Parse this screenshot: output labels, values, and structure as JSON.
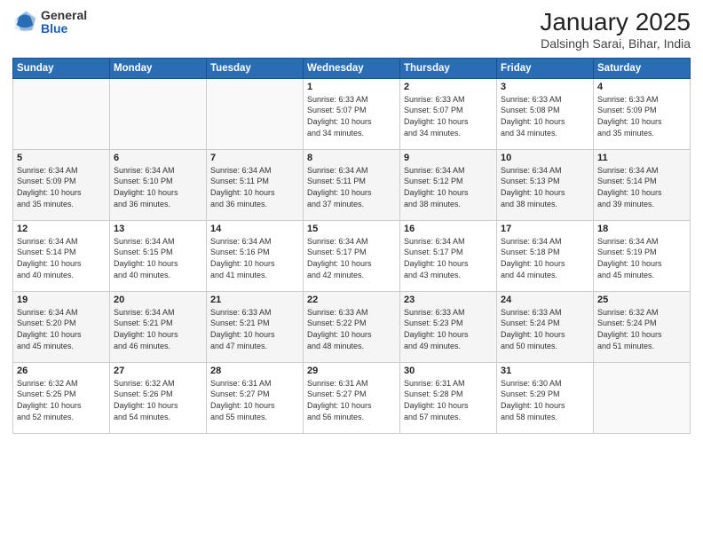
{
  "header": {
    "logo_general": "General",
    "logo_blue": "Blue",
    "month_title": "January 2025",
    "location": "Dalsingh Sarai, Bihar, India"
  },
  "days_of_week": [
    "Sunday",
    "Monday",
    "Tuesday",
    "Wednesday",
    "Thursday",
    "Friday",
    "Saturday"
  ],
  "weeks": [
    [
      {
        "day": "",
        "info": ""
      },
      {
        "day": "",
        "info": ""
      },
      {
        "day": "",
        "info": ""
      },
      {
        "day": "1",
        "info": "Sunrise: 6:33 AM\nSunset: 5:07 PM\nDaylight: 10 hours\nand 34 minutes."
      },
      {
        "day": "2",
        "info": "Sunrise: 6:33 AM\nSunset: 5:07 PM\nDaylight: 10 hours\nand 34 minutes."
      },
      {
        "day": "3",
        "info": "Sunrise: 6:33 AM\nSunset: 5:08 PM\nDaylight: 10 hours\nand 34 minutes."
      },
      {
        "day": "4",
        "info": "Sunrise: 6:33 AM\nSunset: 5:09 PM\nDaylight: 10 hours\nand 35 minutes."
      }
    ],
    [
      {
        "day": "5",
        "info": "Sunrise: 6:34 AM\nSunset: 5:09 PM\nDaylight: 10 hours\nand 35 minutes."
      },
      {
        "day": "6",
        "info": "Sunrise: 6:34 AM\nSunset: 5:10 PM\nDaylight: 10 hours\nand 36 minutes."
      },
      {
        "day": "7",
        "info": "Sunrise: 6:34 AM\nSunset: 5:11 PM\nDaylight: 10 hours\nand 36 minutes."
      },
      {
        "day": "8",
        "info": "Sunrise: 6:34 AM\nSunset: 5:11 PM\nDaylight: 10 hours\nand 37 minutes."
      },
      {
        "day": "9",
        "info": "Sunrise: 6:34 AM\nSunset: 5:12 PM\nDaylight: 10 hours\nand 38 minutes."
      },
      {
        "day": "10",
        "info": "Sunrise: 6:34 AM\nSunset: 5:13 PM\nDaylight: 10 hours\nand 38 minutes."
      },
      {
        "day": "11",
        "info": "Sunrise: 6:34 AM\nSunset: 5:14 PM\nDaylight: 10 hours\nand 39 minutes."
      }
    ],
    [
      {
        "day": "12",
        "info": "Sunrise: 6:34 AM\nSunset: 5:14 PM\nDaylight: 10 hours\nand 40 minutes."
      },
      {
        "day": "13",
        "info": "Sunrise: 6:34 AM\nSunset: 5:15 PM\nDaylight: 10 hours\nand 40 minutes."
      },
      {
        "day": "14",
        "info": "Sunrise: 6:34 AM\nSunset: 5:16 PM\nDaylight: 10 hours\nand 41 minutes."
      },
      {
        "day": "15",
        "info": "Sunrise: 6:34 AM\nSunset: 5:17 PM\nDaylight: 10 hours\nand 42 minutes."
      },
      {
        "day": "16",
        "info": "Sunrise: 6:34 AM\nSunset: 5:17 PM\nDaylight: 10 hours\nand 43 minutes."
      },
      {
        "day": "17",
        "info": "Sunrise: 6:34 AM\nSunset: 5:18 PM\nDaylight: 10 hours\nand 44 minutes."
      },
      {
        "day": "18",
        "info": "Sunrise: 6:34 AM\nSunset: 5:19 PM\nDaylight: 10 hours\nand 45 minutes."
      }
    ],
    [
      {
        "day": "19",
        "info": "Sunrise: 6:34 AM\nSunset: 5:20 PM\nDaylight: 10 hours\nand 45 minutes."
      },
      {
        "day": "20",
        "info": "Sunrise: 6:34 AM\nSunset: 5:21 PM\nDaylight: 10 hours\nand 46 minutes."
      },
      {
        "day": "21",
        "info": "Sunrise: 6:33 AM\nSunset: 5:21 PM\nDaylight: 10 hours\nand 47 minutes."
      },
      {
        "day": "22",
        "info": "Sunrise: 6:33 AM\nSunset: 5:22 PM\nDaylight: 10 hours\nand 48 minutes."
      },
      {
        "day": "23",
        "info": "Sunrise: 6:33 AM\nSunset: 5:23 PM\nDaylight: 10 hours\nand 49 minutes."
      },
      {
        "day": "24",
        "info": "Sunrise: 6:33 AM\nSunset: 5:24 PM\nDaylight: 10 hours\nand 50 minutes."
      },
      {
        "day": "25",
        "info": "Sunrise: 6:32 AM\nSunset: 5:24 PM\nDaylight: 10 hours\nand 51 minutes."
      }
    ],
    [
      {
        "day": "26",
        "info": "Sunrise: 6:32 AM\nSunset: 5:25 PM\nDaylight: 10 hours\nand 52 minutes."
      },
      {
        "day": "27",
        "info": "Sunrise: 6:32 AM\nSunset: 5:26 PM\nDaylight: 10 hours\nand 54 minutes."
      },
      {
        "day": "28",
        "info": "Sunrise: 6:31 AM\nSunset: 5:27 PM\nDaylight: 10 hours\nand 55 minutes."
      },
      {
        "day": "29",
        "info": "Sunrise: 6:31 AM\nSunset: 5:27 PM\nDaylight: 10 hours\nand 56 minutes."
      },
      {
        "day": "30",
        "info": "Sunrise: 6:31 AM\nSunset: 5:28 PM\nDaylight: 10 hours\nand 57 minutes."
      },
      {
        "day": "31",
        "info": "Sunrise: 6:30 AM\nSunset: 5:29 PM\nDaylight: 10 hours\nand 58 minutes."
      },
      {
        "day": "",
        "info": ""
      }
    ]
  ]
}
